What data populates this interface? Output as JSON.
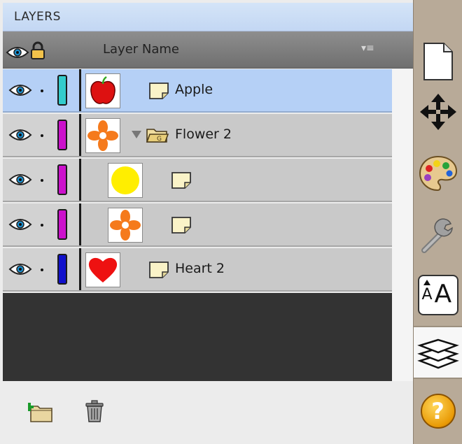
{
  "panel": {
    "title": "LAYERS",
    "column_header": "Layer Name",
    "header_menu_glyph": "▾≡"
  },
  "layers": [
    {
      "name": "Apple",
      "color": "#33cccc",
      "thumb": "apple",
      "selected": true,
      "kind": "layer"
    },
    {
      "name": "Flower 2",
      "color": "#cc11cc",
      "thumb": "flower",
      "selected": false,
      "kind": "group",
      "expanded": true
    },
    {
      "name": "",
      "color": "#cc11cc",
      "thumb": "circle",
      "selected": false,
      "kind": "layer",
      "child": true
    },
    {
      "name": "",
      "color": "#cc11cc",
      "thumb": "flower",
      "selected": false,
      "kind": "layer",
      "child": true
    },
    {
      "name": "Heart 2",
      "color": "#1111cc",
      "thumb": "heart",
      "selected": false,
      "kind": "layer"
    }
  ],
  "toolbar": {
    "text_tool_small": "A",
    "text_tool_large": "A",
    "help_label": "?"
  },
  "icons": {
    "visibility": "eye-icon",
    "lock": "lock-icon",
    "new_folder": "new-folder-icon",
    "trash": "trash-icon",
    "page": "page-icon",
    "move": "move-arrows-icon",
    "palette": "palette-icon",
    "wrench": "wrench-icon",
    "layers": "layers-stack-icon",
    "help": "help-icon"
  },
  "colors": {
    "selected_row": "#b5d0f6",
    "row": "#c9c9c9",
    "title_bar": "#c3d7f3",
    "toolbar": "#b8aa98"
  }
}
